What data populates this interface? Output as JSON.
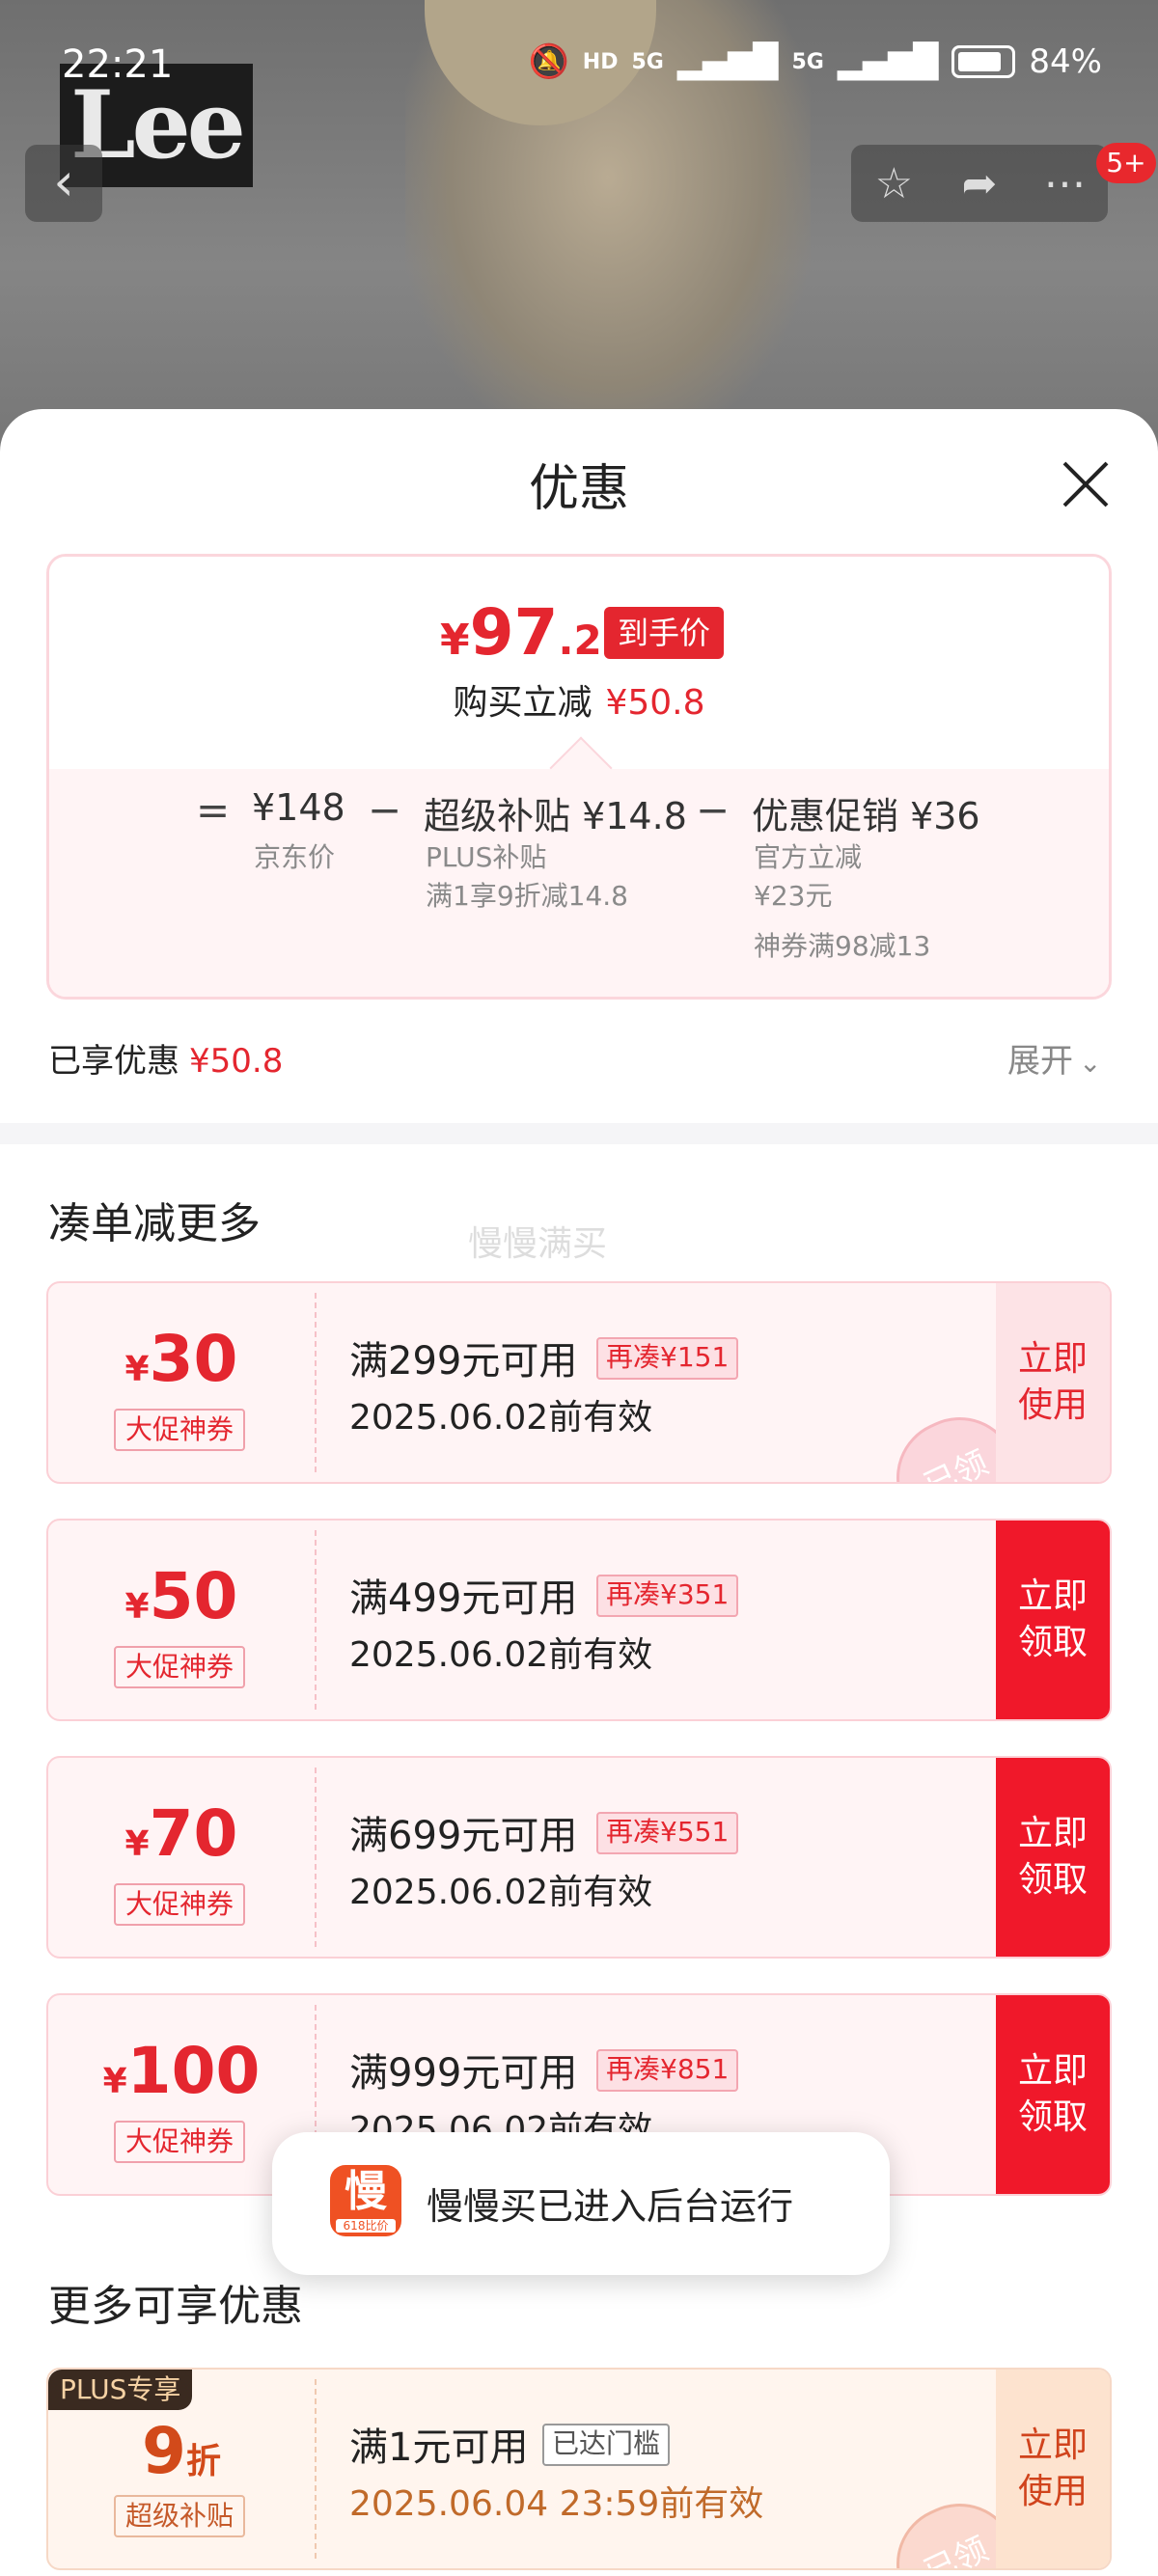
{
  "status_bar": {
    "time": "22:21",
    "network": "HD",
    "signal1": "5G",
    "signal2": "5G",
    "battery": "84%",
    "battery_level": 0.84
  },
  "product": {
    "brand_logo": "Lee"
  },
  "top_actions": {
    "badge": "5+"
  },
  "sheet": {
    "title": "优惠",
    "price": {
      "currency": "¥",
      "integer": "97",
      "decimal": ".2",
      "tag": "到手价",
      "saved_label": "购买立减",
      "saved_value": "¥50.8"
    },
    "formula": {
      "eq": "=",
      "minus": "−",
      "base_value": "¥148",
      "base_label": "京东价",
      "subsidy_title": "超级补贴 ¥14.8",
      "subsidy_line1": "PLUS补贴",
      "subsidy_line2": "满1享9折减14.8",
      "promo_title": "优惠促销 ¥36",
      "promo_line1": "官方立减",
      "promo_line2": "¥23元",
      "promo_line3": "神券满98减13"
    },
    "enjoyed_label": "已享优惠",
    "enjoyed_value": "¥50.8",
    "expand_label": "展开"
  },
  "section_combine": {
    "title": "凑单减更多",
    "watermark": "慢慢满买"
  },
  "coupons": [
    {
      "currency": "¥",
      "amount": "30",
      "type": "大促神券",
      "condition": "满299元可用",
      "gap": "再凑¥151",
      "valid": "2025.06.02前有效",
      "cta": "立即使用",
      "cta_line1": "立即",
      "cta_line2": "使用",
      "stamp": "已领"
    },
    {
      "currency": "¥",
      "amount": "50",
      "type": "大促神券",
      "condition": "满499元可用",
      "gap": "再凑¥351",
      "valid": "2025.06.02前有效",
      "cta_line1": "立即",
      "cta_line2": "领取"
    },
    {
      "currency": "¥",
      "amount": "70",
      "type": "大促神券",
      "condition": "满699元可用",
      "gap": "再凑¥551",
      "valid": "2025.06.02前有效",
      "cta_line1": "立即",
      "cta_line2": "领取"
    },
    {
      "currency": "¥",
      "amount": "100",
      "type": "大促神券",
      "condition": "满999元可用",
      "gap": "再凑¥851",
      "valid": "2025.06.02前有效",
      "cta_line1": "立即",
      "cta_line2": "领取"
    }
  ],
  "toast": {
    "icon_glyph": "慢",
    "icon_sub": "618比价",
    "text": "慢慢买已进入后台运行"
  },
  "section_more": {
    "title": "更多可享优惠"
  },
  "plus_coupon": {
    "tag": "PLUS专享",
    "amount": "9",
    "unit": "折",
    "type": "超级补贴",
    "condition": "满1元可用",
    "gap": "已达门槛",
    "valid": "2025.06.04 23:59前有效",
    "cta_line1": "立即",
    "cta_line2": "使用",
    "stamp": "已领"
  }
}
